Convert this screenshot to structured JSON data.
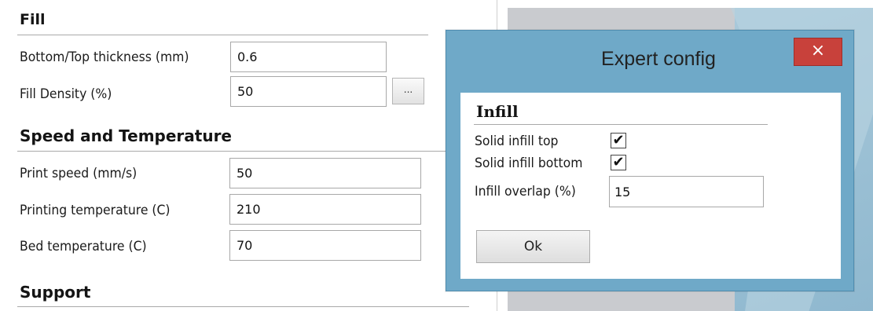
{
  "settings": {
    "fill": {
      "title": "Fill",
      "bottom_top_thickness": {
        "label": "Bottom/Top thickness (mm)",
        "value": "0.6"
      },
      "fill_density": {
        "label": "Fill Density (%)",
        "value": "50",
        "more_label": "..."
      }
    },
    "speed": {
      "title": "Speed and Temperature",
      "print_speed": {
        "label": "Print speed (mm/s)",
        "value": "50"
      },
      "printing_temperature": {
        "label": "Printing temperature (C)",
        "value": "210"
      },
      "bed_temperature": {
        "label": "Bed temperature (C)",
        "value": "70"
      }
    },
    "support": {
      "title": "Support"
    }
  },
  "dialog": {
    "title": "Expert config",
    "close_label": "×",
    "infill": {
      "title": "Infill",
      "solid_infill_top": {
        "label": "Solid infill top",
        "checked": true,
        "mark": "✔"
      },
      "solid_infill_bottom": {
        "label": "Solid infill bottom",
        "checked": true,
        "mark": "✔"
      },
      "infill_overlap": {
        "label": "Infill overlap (%)",
        "value": "15"
      }
    },
    "ok_label": "Ok"
  },
  "colors": {
    "dialog_frame": "#6fa9c8",
    "close_button": "#c8413b",
    "preview_gray": "#c9cbcf",
    "preview_blue": "#8fb8cf"
  }
}
